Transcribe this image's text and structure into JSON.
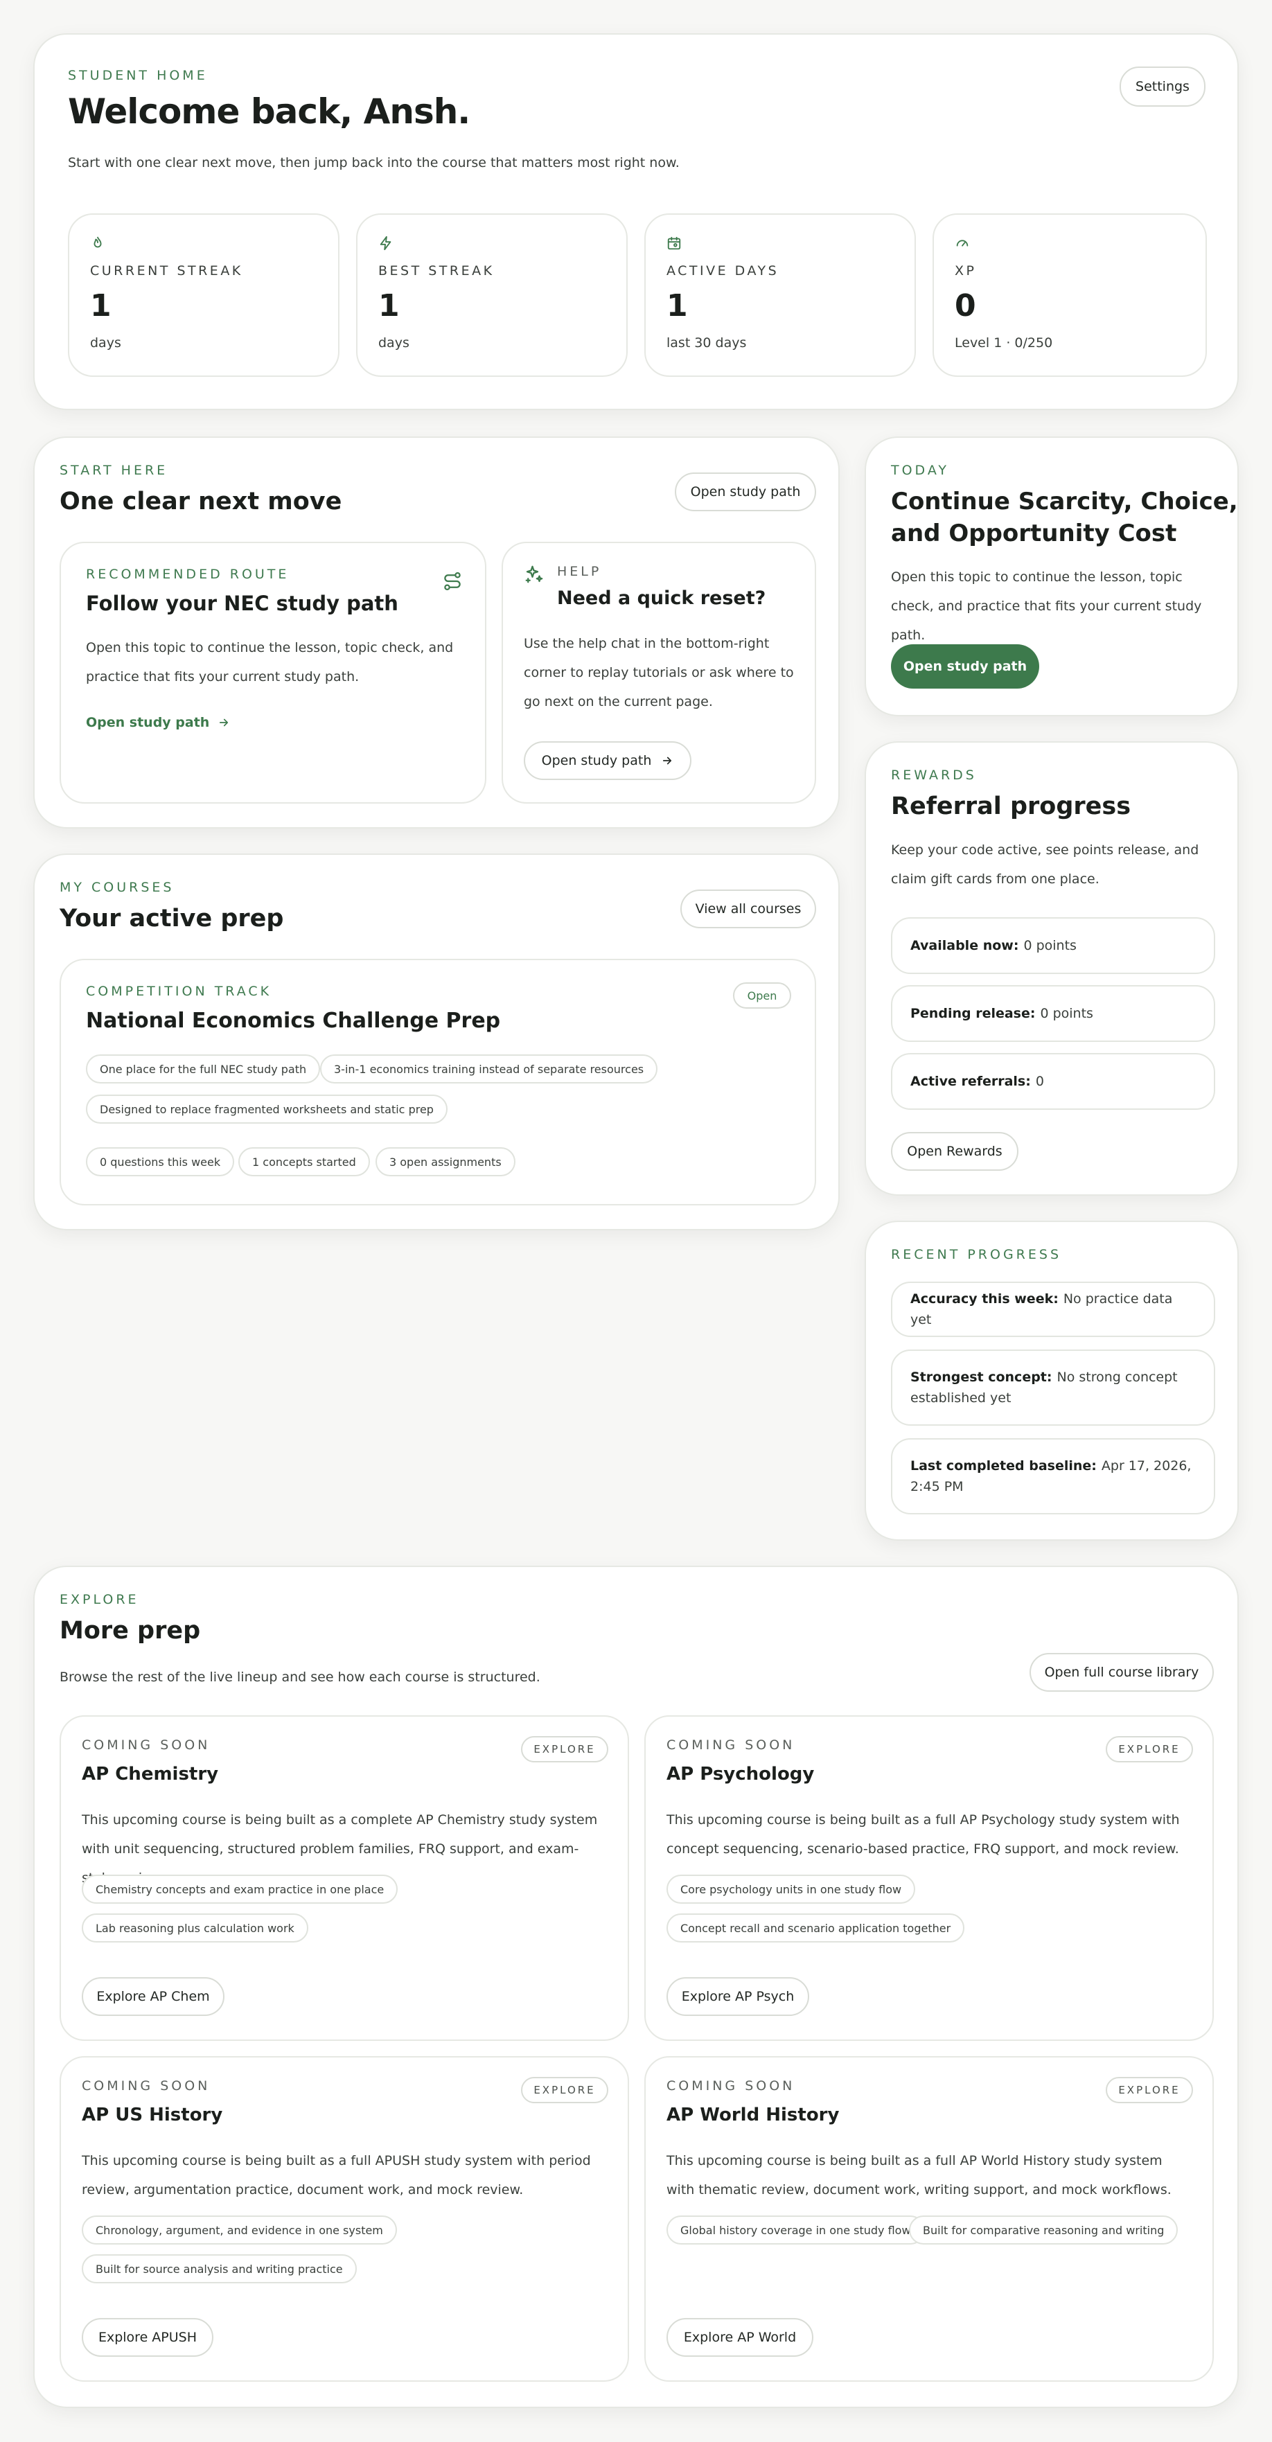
{
  "header": {
    "eyebrow": "STUDENT HOME",
    "title": "Welcome back, Ansh.",
    "subtitle": "Start with one clear next move, then jump back into the course that matters most right now.",
    "settings_label": "Settings"
  },
  "stats": [
    {
      "icon": "flame-icon",
      "label": "CURRENT STREAK",
      "value": "1",
      "sub": "days"
    },
    {
      "icon": "zap-icon",
      "label": "BEST STREAK",
      "value": "1",
      "sub": "days"
    },
    {
      "icon": "calendar-icon",
      "label": "ACTIVE DAYS",
      "value": "1",
      "sub": "last 30 days"
    },
    {
      "icon": "gauge-icon",
      "label": "XP",
      "value": "0",
      "sub": "Level 1 · 0/250"
    }
  ],
  "start_here": {
    "eyebrow": "START HERE",
    "title": "One clear next move",
    "button": "Open study path",
    "route": {
      "eyebrow": "RECOMMENDED ROUTE",
      "title": "Follow your NEC study path",
      "body": "Open this topic to continue the lesson, topic check, and practice that fits your current study path.",
      "link": "Open study path"
    },
    "help": {
      "eyebrow": "HELP",
      "title": "Need a quick reset?",
      "body": "Use the help chat in the bottom-right corner to replay tutorials or ask where to go next on the current page.",
      "button": "Open study path"
    }
  },
  "today": {
    "eyebrow": "TODAY",
    "title_line1": "Continue Scarcity, Choice,",
    "title_line2": "and Opportunity Cost",
    "body": "Open this topic to continue the lesson, topic check, and practice that fits your current study path.",
    "button": "Open study path"
  },
  "courses": {
    "eyebrow": "MY COURSES",
    "title": "Your active prep",
    "view_all": "View all courses",
    "course": {
      "eyebrow": "COMPETITION TRACK",
      "badge": "Open",
      "title": "National Economics Challenge Prep",
      "features": [
        "One place for the full NEC study path",
        "3-in-1 economics training instead of separate resources",
        "Designed to replace fragmented worksheets and static prep"
      ],
      "metrics": [
        "0 questions this week",
        "1 concepts started",
        "3 open assignments"
      ]
    }
  },
  "rewards": {
    "eyebrow": "REWARDS",
    "title": "Referral progress",
    "body": "Keep your code active, see points release, and claim gift cards from one place.",
    "rows": [
      {
        "label": "Available now:",
        "value": "0 points"
      },
      {
        "label": "Pending release:",
        "value": "0 points"
      },
      {
        "label": "Active referrals:",
        "value": "0"
      }
    ],
    "button": "Open Rewards"
  },
  "recent": {
    "eyebrow": "RECENT PROGRESS",
    "rows": [
      {
        "label": "Accuracy this week:",
        "value": "No practice data yet"
      },
      {
        "label": "Strongest concept:",
        "value": "No strong concept established yet"
      },
      {
        "label": "Last completed baseline:",
        "value": "Apr 17, 2026, 2:45 PM"
      }
    ]
  },
  "explore": {
    "eyebrow": "EXPLORE",
    "title": "More prep",
    "subtitle": "Browse the rest of the live lineup and see how each course is structured.",
    "library_button": "Open full course library",
    "courses": [
      {
        "eyebrow": "COMING SOON",
        "tag": "EXPLORE",
        "title": "AP Chemistry",
        "body": "This upcoming course is being built as a complete AP Chemistry study system with unit sequencing, structured problem families, FRQ support, and exam-style review.",
        "chips": [
          "Chemistry concepts and exam practice in one place",
          "Lab reasoning plus calculation work"
        ],
        "button": "Explore AP Chem"
      },
      {
        "eyebrow": "COMING SOON",
        "tag": "EXPLORE",
        "title": "AP Psychology",
        "body": "This upcoming course is being built as a full AP Psychology study system with concept sequencing, scenario-based practice, FRQ support, and mock review.",
        "chips": [
          "Core psychology units in one study flow",
          "Concept recall and scenario application together"
        ],
        "button": "Explore AP Psych"
      },
      {
        "eyebrow": "COMING SOON",
        "tag": "EXPLORE",
        "title": "AP US History",
        "body": "This upcoming course is being built as a full APUSH study system with period review, argumentation practice, document work, and mock review.",
        "chips": [
          "Chronology, argument, and evidence in one system",
          "Built for source analysis and writing practice"
        ],
        "button": "Explore APUSH"
      },
      {
        "eyebrow": "COMING SOON",
        "tag": "EXPLORE",
        "title": "AP World History",
        "body": "This upcoming course is being built as a full AP World History study system with thematic review, document work, writing support, and mock workflows.",
        "chips": [
          "Global history coverage in one study flow",
          "Built for comparative reasoning and writing"
        ],
        "button": "Explore AP World"
      }
    ]
  },
  "colors": {
    "accent": "#3d7a4c",
    "background": "#f7f7f5",
    "border": "#e6e8e3"
  }
}
